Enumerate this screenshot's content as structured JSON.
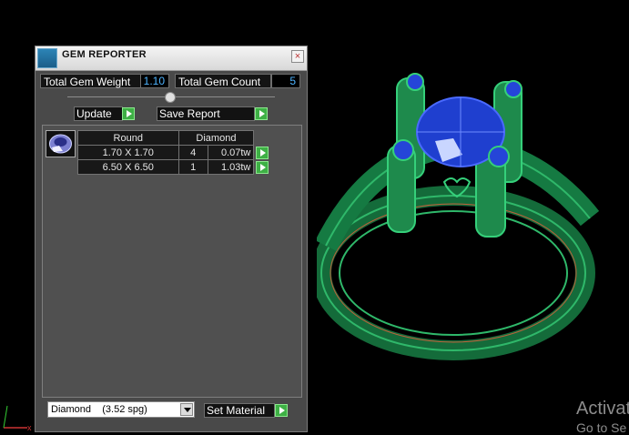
{
  "panel": {
    "title": "GEM REPORTER",
    "close_label": "×",
    "total_weight_label": "Total Gem Weight",
    "total_weight_value": "1.10",
    "total_count_label": "Total Gem Count",
    "total_count_value": "5",
    "update_label": "Update",
    "save_report_label": "Save Report",
    "slider_level_percent": 50
  },
  "gem_table": {
    "shape_header": "Round",
    "material_header": "Diamond",
    "rows": [
      {
        "size": "1.70 X 1.70",
        "count": "4",
        "weight": "0.07tw"
      },
      {
        "size": "6.50 X 6.50",
        "count": "1",
        "weight": "1.03tw"
      }
    ]
  },
  "material": {
    "selected": "Diamond    (3.52 spg)",
    "set_label": "Set Material"
  },
  "watermark": {
    "line1": "Activat",
    "line2": "Go to Se"
  },
  "colors": {
    "accent_green": "#3eb045",
    "value_blue": "#4fb4ff",
    "ring_green": "#2fb86a",
    "gem_blue": "#1f3fcf"
  }
}
